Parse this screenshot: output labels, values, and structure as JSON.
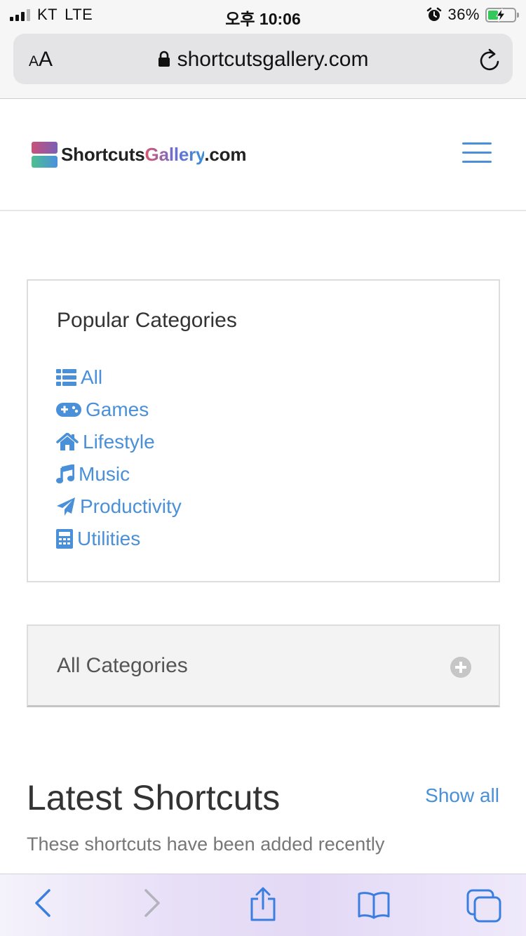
{
  "status_bar": {
    "carrier": "KT",
    "network": "LTE",
    "time": "오후 10:06",
    "battery_percent": "36%"
  },
  "browser": {
    "text_size_label_small": "A",
    "text_size_label_large": "A",
    "url": "shortcutsgallery.com"
  },
  "site": {
    "logo_text_1": "Shortcuts",
    "logo_text_2": "Gallery",
    "logo_text_3": ".com"
  },
  "popular": {
    "title": "Popular Categories",
    "items": [
      {
        "label": "All",
        "icon": "list-icon"
      },
      {
        "label": "Games",
        "icon": "gamepad-icon"
      },
      {
        "label": "Lifestyle",
        "icon": "home-icon"
      },
      {
        "label": "Music",
        "icon": "music-note-icon"
      },
      {
        "label": "Productivity",
        "icon": "paper-plane-icon"
      },
      {
        "label": "Utilities",
        "icon": "calculator-icon"
      }
    ]
  },
  "all_categories": {
    "label": "All Categories"
  },
  "latest": {
    "title": "Latest Shortcuts",
    "show_all": "Show all",
    "subtitle": "These shortcuts have been added recently"
  },
  "colors": {
    "link": "#4a90d9",
    "text": "#333333",
    "muted": "#777777"
  }
}
